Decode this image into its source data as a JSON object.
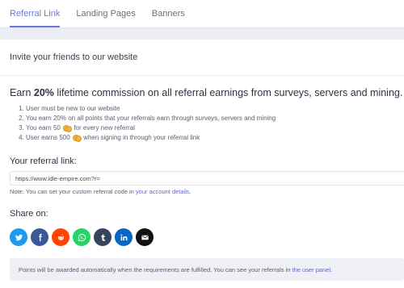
{
  "tabs": [
    {
      "label": "Referral Link",
      "active": true
    },
    {
      "label": "Landing Pages",
      "active": false
    },
    {
      "label": "Banners",
      "active": false
    }
  ],
  "card": {
    "title": "Invite your friends to our website",
    "earn_prefix": "Earn ",
    "earn_bold": "20%",
    "earn_suffix": " lifetime commission on all referral earnings from surveys, servers and mining.",
    "rules": {
      "r1": "User must be new to our website",
      "r2": "You earn 20% on all points that your referrals earn through surveys, servers and mining",
      "r3_before": "You earn 50",
      "r3_after": "for every new referral",
      "r4_before": "User earns 500",
      "r4_after": "when signing in through your referral link"
    },
    "coin_icon": "coins-icon",
    "referral_label": "Your referral link:",
    "referral_value": "https://www.idle-empire.com?r=",
    "note_prefix": "Note: You can set your custom referral code in ",
    "note_link": "your account details",
    "note_suffix": ".",
    "share_label": "Share on:",
    "info_prefix": "Points will be awarded automatically when the requirements are fulfilled. You can see your referrals in ",
    "info_link": "the user panel",
    "info_suffix": "."
  },
  "socials": [
    {
      "name": "twitter-icon",
      "color": "#1d9bf0"
    },
    {
      "name": "facebook-icon",
      "color": "#3b5998"
    },
    {
      "name": "reddit-icon",
      "color": "#ff4500"
    },
    {
      "name": "whatsapp-icon",
      "color": "#25d366"
    },
    {
      "name": "tumblr-icon",
      "color": "#35465c"
    },
    {
      "name": "linkedin-icon",
      "color": "#0a66c2"
    },
    {
      "name": "email-icon",
      "color": "#111111"
    }
  ]
}
